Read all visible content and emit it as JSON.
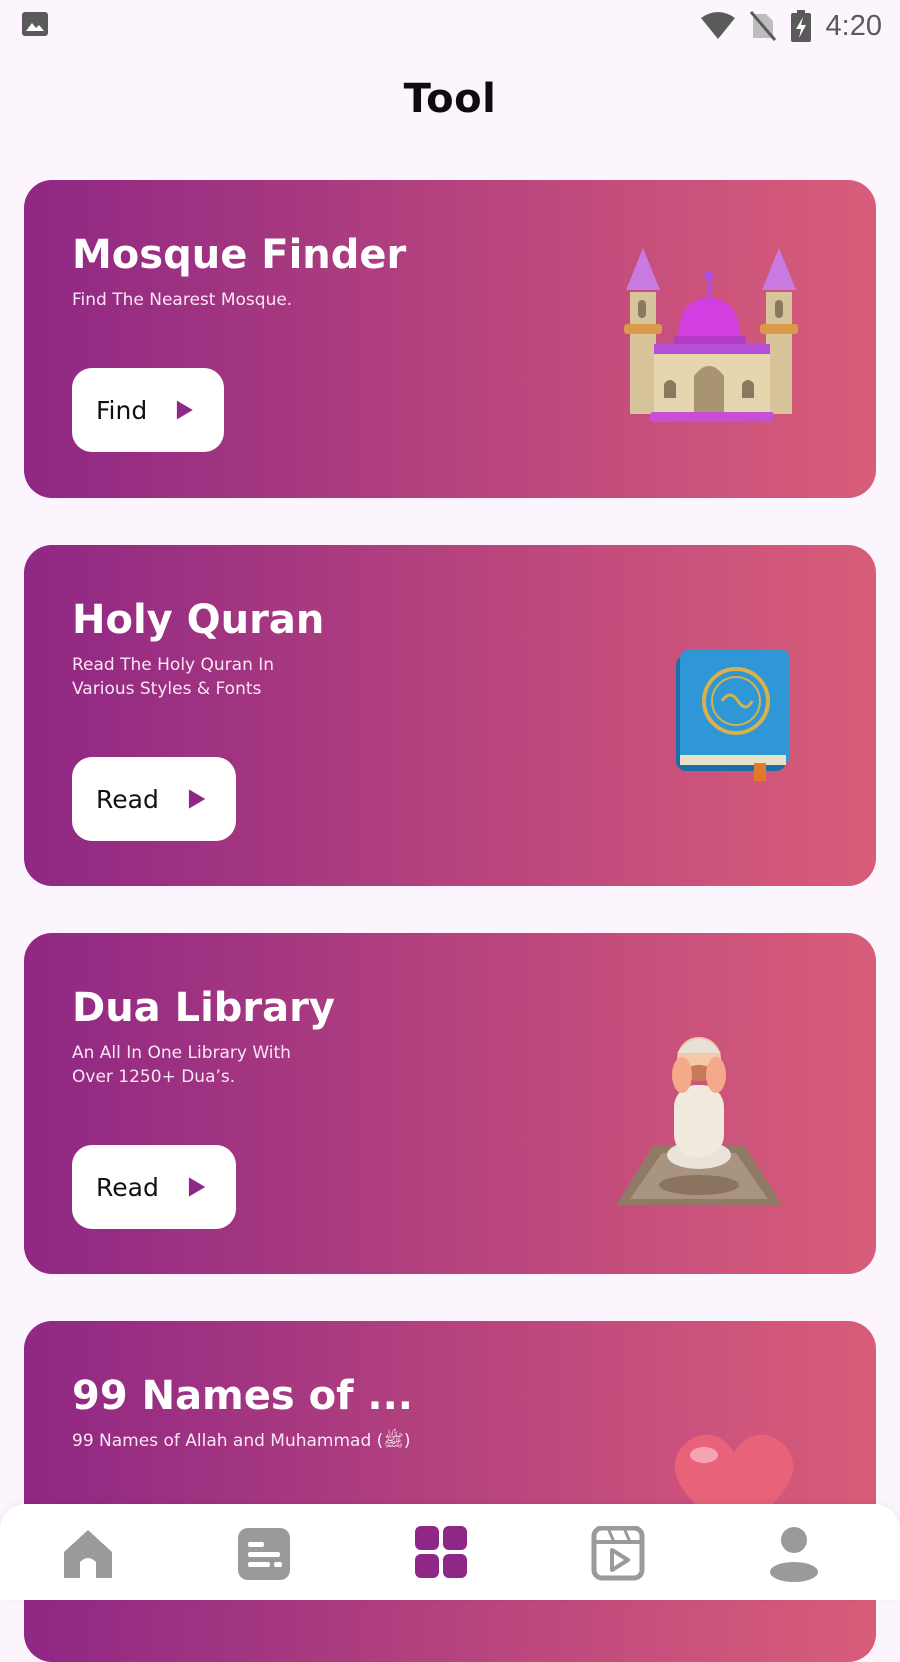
{
  "status_bar": {
    "time": "4:20",
    "icons": [
      "gallery-icon",
      "wifi-icon",
      "no-sim-icon",
      "battery-charging-icon"
    ]
  },
  "header": {
    "title": "Tool"
  },
  "cards": [
    {
      "title": "Mosque Finder",
      "description": "Find The Nearest Mosque.",
      "button_label": "Find",
      "illustration": "mosque-icon"
    },
    {
      "title": "Holy Quran",
      "description": "Read The Holy Quran In\nVarious Styles & Fonts",
      "button_label": "Read",
      "illustration": "quran-book-icon"
    },
    {
      "title": "Dua Library",
      "description": "An All In One Library With\n Over  1250+ Dua’s.",
      "button_label": "Read",
      "illustration": "praying-man-icon"
    },
    {
      "title": "99 Names of ...",
      "description": "99 Names of Allah and Muhammad (ﷺ)",
      "illustration": "heart-icon"
    }
  ],
  "bottom_nav": {
    "items": [
      {
        "icon": "home-icon",
        "active": false
      },
      {
        "icon": "articles-icon",
        "active": false
      },
      {
        "icon": "tools-grid-icon",
        "active": true
      },
      {
        "icon": "video-icon",
        "active": false
      },
      {
        "icon": "profile-icon",
        "active": false
      }
    ],
    "active_color": "#8e2786",
    "inactive_color": "#9a9a9a"
  },
  "colors": {
    "background": "#fdf5fd",
    "card_gradient_start": "#8f2784",
    "card_gradient_end": "#d85d79",
    "accent": "#8e2786"
  }
}
